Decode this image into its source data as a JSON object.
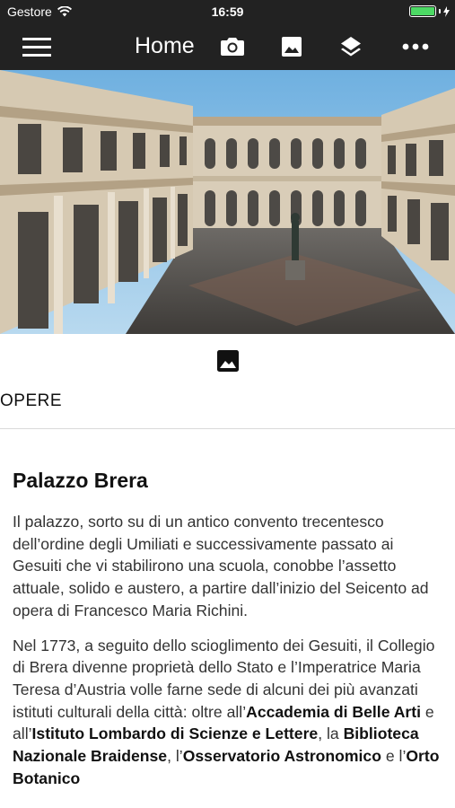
{
  "status_bar": {
    "carrier": "Gestore",
    "time": "16:59"
  },
  "nav": {
    "title": "Home",
    "icons": [
      "menu-icon",
      "camera-icon",
      "image-icon",
      "layers-icon",
      "more-icon"
    ]
  },
  "opere": {
    "label": "OPERE",
    "icon": "image-icon"
  },
  "article": {
    "title": "Palazzo Brera",
    "paragraph1": "Il palazzo, sorto su di un antico convento trecentesco dell’ordine degli Umiliati e successivamente passato ai Gesuiti che vi stabilirono una scuola, conobbe l’assetto attuale, solido e austero, a partire dall’inizio del Seicento ad opera di Francesco Maria Richini.",
    "paragraph2": {
      "t1": "Nel 1773, a seguito dello scioglimento dei Gesuiti, il Collegio di Brera divenne proprietà dello Stato e l’Imperatrice Maria Teresa d’Austria volle farne sede di alcuni dei più avanzati istituti culturali della città: oltre all’",
      "b1": "Accademia di Belle Arti",
      "t2": " e all’",
      "b2": "Istituto Lombardo di Scienze e Lettere",
      "t3": ", la ",
      "b3": "Biblioteca Nazionale Braidense",
      "t4": ", l’",
      "b4": "Osservatorio Astronomico",
      "t5": " e l’",
      "b5": "Orto Botanico"
    }
  },
  "colors": {
    "bar_bg": "#222222",
    "battery": "#4cd964",
    "sky": "#8ec3e6"
  }
}
